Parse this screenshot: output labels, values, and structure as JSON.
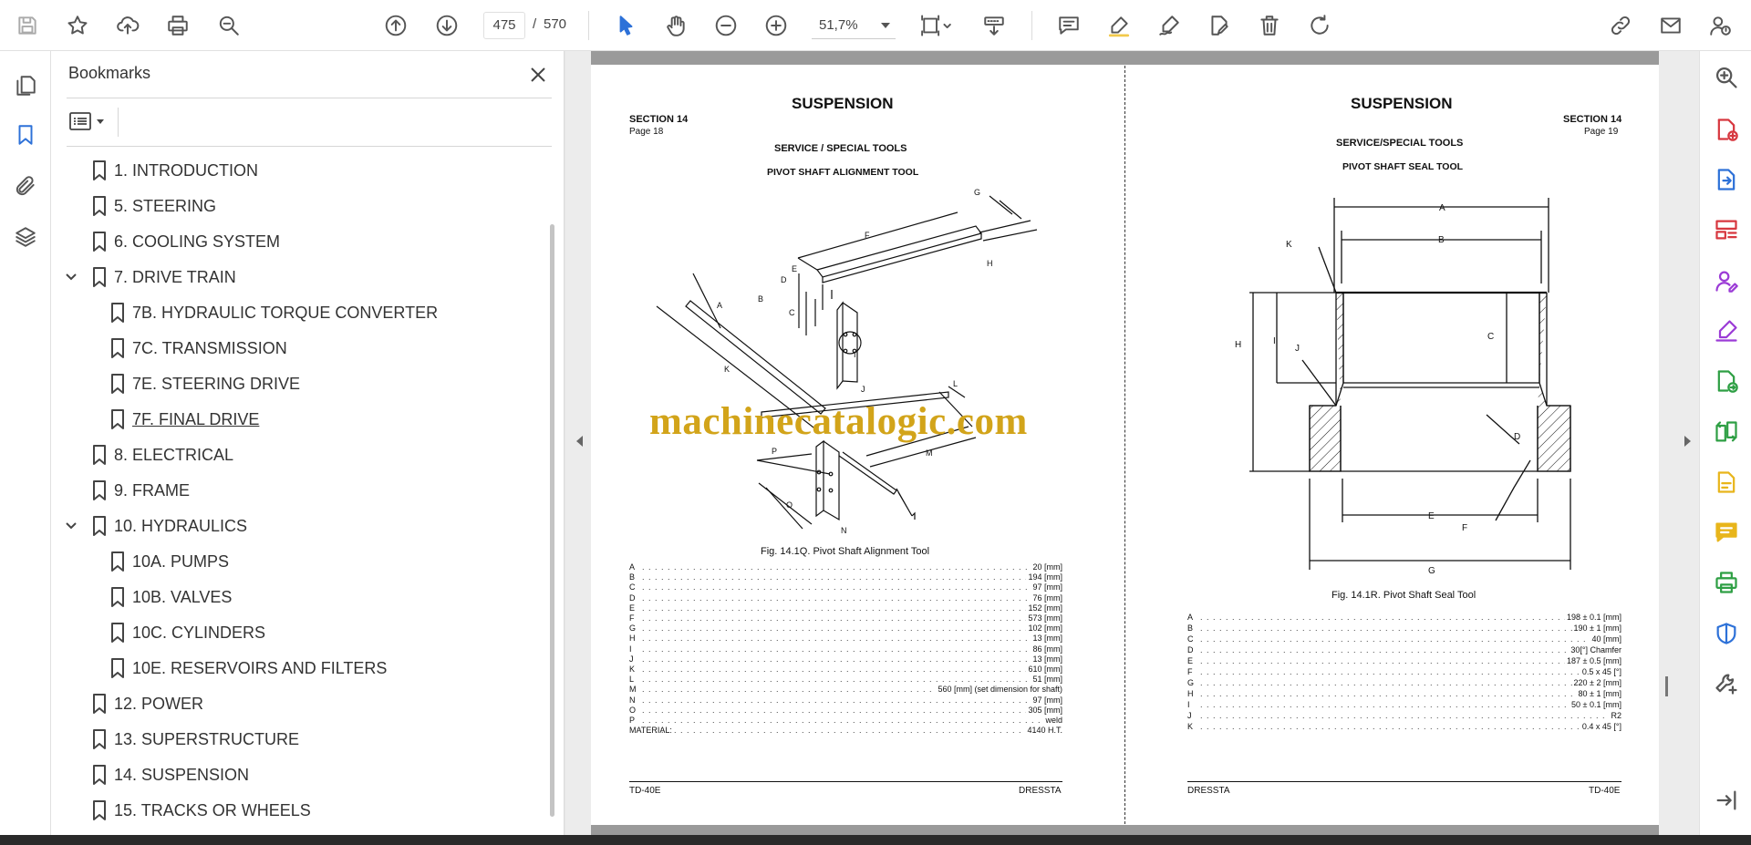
{
  "toolbar": {
    "current_page": "475",
    "page_separator": "/",
    "total_pages": "570",
    "zoom": "51,7%"
  },
  "bookmarks": {
    "title": "Bookmarks",
    "items": [
      {
        "label": "1. INTRODUCTION",
        "level": 0,
        "expandable": false
      },
      {
        "label": "5. STEERING",
        "level": 0,
        "expandable": false
      },
      {
        "label": "6. COOLING SYSTEM",
        "level": 0,
        "expandable": false
      },
      {
        "label": "7. DRIVE TRAIN",
        "level": 0,
        "expandable": true
      },
      {
        "label": "7B. HYDRAULIC TORQUE CONVERTER",
        "level": 1,
        "expandable": false
      },
      {
        "label": "7C. TRANSMISSION",
        "level": 1,
        "expandable": false
      },
      {
        "label": "7E. STEERING DRIVE",
        "level": 1,
        "expandable": false
      },
      {
        "label": "7F. FINAL DRIVE",
        "level": 1,
        "expandable": false,
        "hovered": true
      },
      {
        "label": "8. ELECTRICAL",
        "level": 0,
        "expandable": false
      },
      {
        "label": "9. FRAME",
        "level": 0,
        "expandable": false
      },
      {
        "label": "10. HYDRAULICS",
        "level": 0,
        "expandable": true
      },
      {
        "label": "10A. PUMPS",
        "level": 1,
        "expandable": false
      },
      {
        "label": "10B. VALVES",
        "level": 1,
        "expandable": false
      },
      {
        "label": "10C. CYLINDERS",
        "level": 1,
        "expandable": false
      },
      {
        "label": "10E. RESERVOIRS AND FILTERS",
        "level": 1,
        "expandable": false
      },
      {
        "label": "12. POWER",
        "level": 0,
        "expandable": false
      },
      {
        "label": "13. SUPERSTRUCTURE",
        "level": 0,
        "expandable": false
      },
      {
        "label": "14. SUSPENSION",
        "level": 0,
        "expandable": false
      },
      {
        "label": "15. TRACKS OR WHEELS",
        "level": 0,
        "expandable": false
      }
    ]
  },
  "left_page": {
    "title": "SUSPENSION",
    "section": "SECTION 14",
    "page": "Page 18",
    "subtitle": "SERVICE / SPECIAL TOOLS",
    "tool_name": "PIVOT SHAFT ALIGNMENT TOOL",
    "figure_caption": "Fig. 14.1Q.  Pivot Shaft Alignment Tool",
    "specs": [
      {
        "k": "A",
        "v": "20 [mm]"
      },
      {
        "k": "B",
        "v": "194 [mm]"
      },
      {
        "k": "C",
        "v": "97 [mm]"
      },
      {
        "k": "D",
        "v": "76 [mm]"
      },
      {
        "k": "E",
        "v": "152 [mm]"
      },
      {
        "k": "F",
        "v": "573 [mm]"
      },
      {
        "k": "G",
        "v": "102 [mm]"
      },
      {
        "k": "H",
        "v": "13 [mm]"
      },
      {
        "k": "I",
        "v": "86 [mm]"
      },
      {
        "k": "J",
        "v": "13 [mm]"
      },
      {
        "k": "K",
        "v": "610 [mm]"
      },
      {
        "k": "L",
        "v": "51 [mm]"
      },
      {
        "k": "M",
        "v": "560 [mm] (set dimension for shaft)"
      },
      {
        "k": "N",
        "v": "97 [mm]"
      },
      {
        "k": "O",
        "v": "305 [mm]"
      },
      {
        "k": "P",
        "v": "weld"
      },
      {
        "k": "MATERIAL:",
        "v": "4140 H.T."
      }
    ],
    "footer_left": "TD-40E",
    "footer_right": "DRESSTA"
  },
  "right_page": {
    "title": "SUSPENSION",
    "section": "SECTION 14",
    "page": "Page 19",
    "subtitle": "SERVICE/SPECIAL TOOLS",
    "tool_name": "PIVOT SHAFT SEAL TOOL",
    "figure_caption": "Fig. 14.1R.  Pivot Shaft Seal Tool",
    "specs": [
      {
        "k": "A",
        "v": "198 ± 0.1 [mm]"
      },
      {
        "k": "B",
        "v": "190 ± 1 [mm]"
      },
      {
        "k": "C",
        "v": "40 [mm]"
      },
      {
        "k": "D",
        "v": "30[°] Chamfer"
      },
      {
        "k": "E",
        "v": "187 ± 0.5 [mm]"
      },
      {
        "k": "F",
        "v": "0.5 x 45 [°]"
      },
      {
        "k": "G",
        "v": "220 ± 2 [mm]"
      },
      {
        "k": "H",
        "v": "80 ± 1 [mm]"
      },
      {
        "k": "I",
        "v": "50 ± 0.1 [mm]"
      },
      {
        "k": "J",
        "v": "R2"
      },
      {
        "k": "K",
        "v": "0.4 x 45 [°]"
      }
    ],
    "footer_left": "DRESSTA",
    "footer_right": "TD-40E"
  },
  "diagram_labels": {
    "left": [
      "A",
      "B",
      "C",
      "D",
      "E",
      "F",
      "G",
      "H",
      "I",
      "J",
      "K",
      "L",
      "M",
      "N",
      "O",
      "P"
    ],
    "right": [
      "A",
      "B",
      "C",
      "D",
      "E",
      "F",
      "G",
      "H",
      "I",
      "J",
      "K"
    ]
  },
  "watermark": "machinecatalogic.com",
  "colors": {
    "watermark": "#d2a41a",
    "rail_red": "#d7373f",
    "rail_blue": "#2d71d8",
    "rail_purple": "#9b3bd6",
    "rail_green": "#2e9f44",
    "rail_yellow": "#e8b51b"
  }
}
